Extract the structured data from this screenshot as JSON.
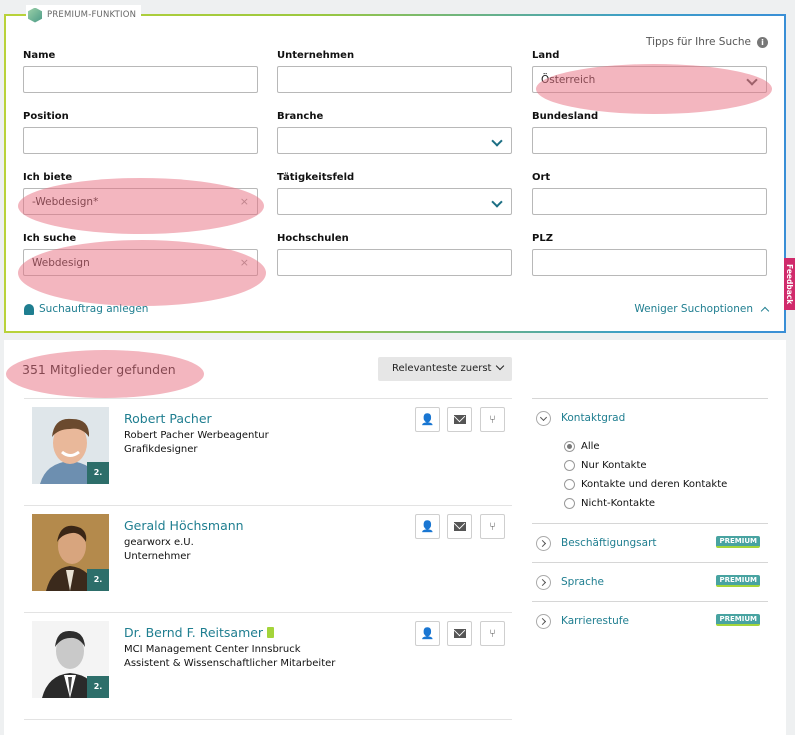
{
  "premium_label": "PREMIUM-FUNKTION",
  "tips_label": "Tipps für Ihre Suche",
  "fields": {
    "name": {
      "label": "Name",
      "value": ""
    },
    "unternehmen": {
      "label": "Unternehmen",
      "value": ""
    },
    "land": {
      "label": "Land",
      "value": "Österreich"
    },
    "position": {
      "label": "Position",
      "value": ""
    },
    "branche": {
      "label": "Branche",
      "value": ""
    },
    "bundesland": {
      "label": "Bundesland",
      "value": ""
    },
    "ich_biete": {
      "label": "Ich biete",
      "value": "-Webdesign*"
    },
    "taetigkeitsfeld": {
      "label": "Tätigkeitsfeld",
      "value": ""
    },
    "ort": {
      "label": "Ort",
      "value": ""
    },
    "ich_suche": {
      "label": "Ich suche",
      "value": "Webdesign"
    },
    "hochschulen": {
      "label": "Hochschulen",
      "value": ""
    },
    "plz": {
      "label": "PLZ",
      "value": ""
    }
  },
  "clear_symbol": "×",
  "save_search_label": "Suchauftrag anlegen",
  "fewer_options_label": "Weniger Suchoptionen",
  "feedback_label": "Feedback",
  "results": {
    "count_label": "351 Mitglieder gefunden",
    "sort_label": "Relevanteste zuerst"
  },
  "members": [
    {
      "name": "Robert Pacher",
      "company": "Robert Pacher Werbeagentur",
      "role": "Grafikdesigner",
      "degree": "2."
    },
    {
      "name": "Gerald Höchsmann",
      "company": "gearworx e.U.",
      "role": "Unternehmer",
      "degree": "2."
    },
    {
      "name": "Dr. Bernd F. Reitsamer",
      "company": "MCI Management Center Innsbruck",
      "role": "Assistent & Wissenschaftlicher Mitarbeiter",
      "degree": "2."
    }
  ],
  "filters": {
    "kontaktgrad": {
      "title": "Kontaktgrad",
      "options": [
        "Alle",
        "Nur Kontakte",
        "Kontakte und deren Kontakte",
        "Nicht-Kontakte"
      ],
      "selected": "Alle"
    },
    "beschaeftigungsart": {
      "title": "Beschäftigungsart",
      "badge": "PREMIUM"
    },
    "sprache": {
      "title": "Sprache",
      "badge": "PREMIUM"
    },
    "karrierestufe": {
      "title": "Karrierestufe",
      "badge": "PREMIUM"
    }
  },
  "colors": {
    "accent_teal": "#1f7e90",
    "highlight_red": "#e86e80",
    "premium_badge": "#48a3a1",
    "degree_badge": "#2d6e6a",
    "feedback_tab": "#d02a6b"
  }
}
